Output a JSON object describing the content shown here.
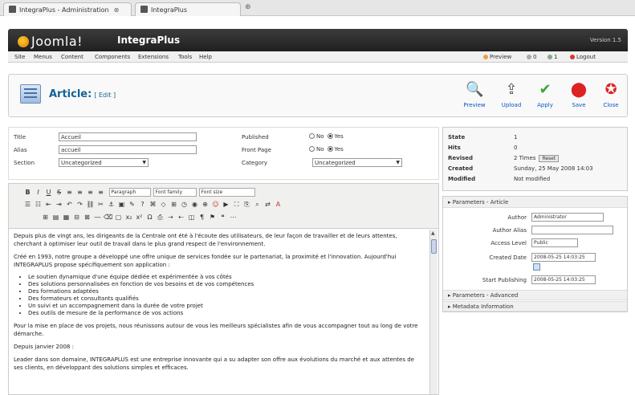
{
  "browser": {
    "tabs": [
      {
        "label": "IntegraPlus - Administration"
      },
      {
        "label": "IntegraPlus"
      }
    ],
    "new_tab_glyph": "⊕",
    "close_glyph": "⊗"
  },
  "header": {
    "logo_text": "Joomla!",
    "site_name": "IntegraPlus",
    "version": "Version 1.5"
  },
  "menubar": {
    "items": [
      "Site",
      "Menus",
      "Content",
      "Components",
      "Extensions",
      "Tools",
      "Help"
    ],
    "preview": "Preview",
    "messages": "0",
    "users": "1",
    "logout": "Logout"
  },
  "toolbar": {
    "title": "Article:",
    "subtitle": "[ Edit ]",
    "buttons": [
      {
        "label": "Preview",
        "icon": "preview-icon",
        "glyph": "🔍"
      },
      {
        "label": "Upload",
        "icon": "upload-icon",
        "glyph": "⇪"
      },
      {
        "label": "Apply",
        "icon": "apply-icon",
        "glyph": "✔"
      },
      {
        "label": "Save",
        "icon": "save-icon",
        "glyph": "⬤"
      },
      {
        "label": "Close",
        "icon": "close-icon",
        "glyph": "✪"
      }
    ]
  },
  "form": {
    "title_label": "Title",
    "title_value": "Accueil",
    "alias_label": "Alias",
    "alias_value": "accueil",
    "section_label": "Section",
    "section_value": "Uncategorized",
    "published_label": "Published",
    "published_no": "No",
    "published_yes": "Yes",
    "frontpage_label": "Front Page",
    "frontpage_no": "No",
    "frontpage_yes": "Yes",
    "category_label": "Category",
    "category_value": "Uncategorized"
  },
  "editor": {
    "format_select": "Paragraph",
    "font_select": "Font family",
    "size_select": "Font size",
    "para1": "Depuis plus de vingt ans, les dirigeants de la Centrale ont été à l'écoute des utilisateurs, de leur façon de travailler et de leurs attentes, cherchant à optimiser leur outil de travail dans le plus grand respect de l'environnement.",
    "para2": "Créé en 1993, notre groupe a développé une offre unique de services fondée sur le partenariat, la proximité et l'innovation. Aujourd'hui INTEGRAPLUS propose spécifiquement son application :",
    "list": [
      "Le soutien dynamique d'une équipe dédiée et expérimentée à vos côtés",
      "Des solutions personnalisées en fonction de vos besoins et de vos compétences",
      "Des formations adaptées",
      "Des formateurs et consultants qualifiés",
      "Un suivi et un accompagnement dans la durée de votre projet",
      "Des outils de mesure de la performance de vos actions"
    ],
    "para3": "Pour la mise en place de vos projets, nous réunissons autour de vous les meilleurs spécialistes afin de vous accompagner tout au long de votre démarche.",
    "para4": "Depuis janvier 2008 :",
    "para5": "Leader dans son domaine, INTEGRAPLUS est une entreprise innovante qui a su adapter son offre aux évolutions du marché et aux attentes de ses clients, en développant des solutions simples et efficaces."
  },
  "info": {
    "rows": [
      {
        "key": "State",
        "value": "1"
      },
      {
        "key": "Hits",
        "value": "0"
      },
      {
        "key": "Revised",
        "value": "2 Times"
      },
      {
        "key": "Created",
        "value": "Sunday, 25 May 2008 14:03"
      },
      {
        "key": "Modified",
        "value": "Not modified"
      }
    ],
    "reset_label": "Reset"
  },
  "params": {
    "header": "Parameters - Article",
    "author_label": "Author",
    "author_value": "Administrator",
    "alias_label": "Author Alias",
    "access_label": "Access Level",
    "access_value": "Public",
    "created_label": "Created Date",
    "created_value": "2008-05-25 14:03:25",
    "start_label": "Start Publishing",
    "start_value": "2008-05-25 14:03:25",
    "advanced_header": "Parameters - Advanced",
    "metadata_header": "Metadata Information"
  }
}
